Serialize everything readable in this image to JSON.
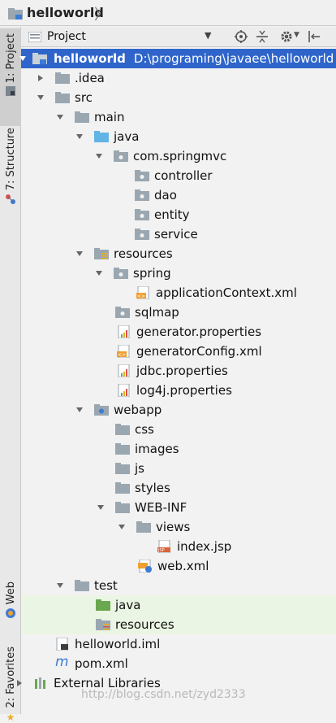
{
  "breadcrumb": {
    "title": "helloworld"
  },
  "strip": {
    "project_tab": "1: Project",
    "structure_tab": "7: Structure",
    "web_tab": "Web",
    "favorites_tab": "2: Favorites"
  },
  "panel": {
    "title": "Project"
  },
  "tree": {
    "root": {
      "label": "helloworld",
      "path": "D:\\programing\\javaee\\helloworld"
    },
    "idea": ".idea",
    "src": "src",
    "main": "main",
    "java": "java",
    "package": "com.springmvc",
    "controller": "controller",
    "dao": "dao",
    "entity": "entity",
    "service": "service",
    "resources": "resources",
    "spring": "spring",
    "appctx": "applicationContext.xml",
    "sqlmap": "sqlmap",
    "genprops": "generator.properties",
    "genconfig": "generatorConfig.xml",
    "jdbc": "jdbc.properties",
    "log4j": "log4j.properties",
    "webapp": "webapp",
    "css": "css",
    "images": "images",
    "js": "js",
    "styles": "styles",
    "webinf": "WEB-INF",
    "views": "views",
    "indexjsp": "index.jsp",
    "webxml": "web.xml",
    "test": "test",
    "test_java": "java",
    "test_resources": "resources",
    "iml": "helloworld.iml",
    "pom": "pom.xml",
    "libs": "External Libraries"
  },
  "watermark": "http://blog.csdn.net/zyd2333"
}
